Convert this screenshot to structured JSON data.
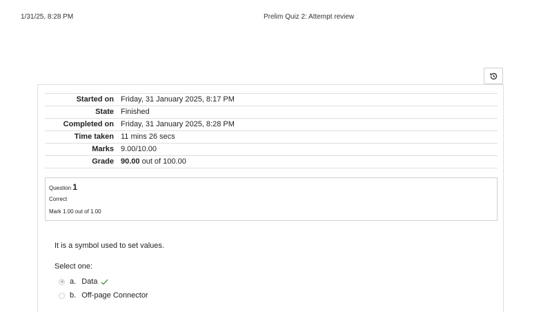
{
  "print_header": {
    "date": "1/31/25, 8:28 PM",
    "title": "Prelim Quiz 2: Attempt review"
  },
  "toolbar": {
    "history_icon": "history-icon"
  },
  "summary": {
    "rows": [
      {
        "label": "Started on",
        "value": "Friday, 31 January 2025, 8:17 PM"
      },
      {
        "label": "State",
        "value": "Finished"
      },
      {
        "label": "Completed on",
        "value": "Friday, 31 January 2025, 8:28 PM"
      },
      {
        "label": "Time taken",
        "value": "11 mins 26 secs"
      },
      {
        "label": "Marks",
        "value": "9.00/10.00"
      }
    ],
    "grade": {
      "label": "Grade",
      "value": "90.00",
      "suffix": " out of 100.00"
    }
  },
  "question": {
    "number_label": "Question ",
    "number": "1",
    "state": "Correct",
    "grade": "Mark 1.00 out of 1.00",
    "text": "It is a symbol used to set values.",
    "prompt": "Select one:",
    "answers": [
      {
        "letter": "a.",
        "text": "Data",
        "selected": true,
        "correct": true
      },
      {
        "letter": "b.",
        "text": "Off-page Connector",
        "selected": false,
        "correct": false
      }
    ]
  },
  "colors": {
    "correct_check": "#2e8b2e",
    "border": "#dedede"
  }
}
